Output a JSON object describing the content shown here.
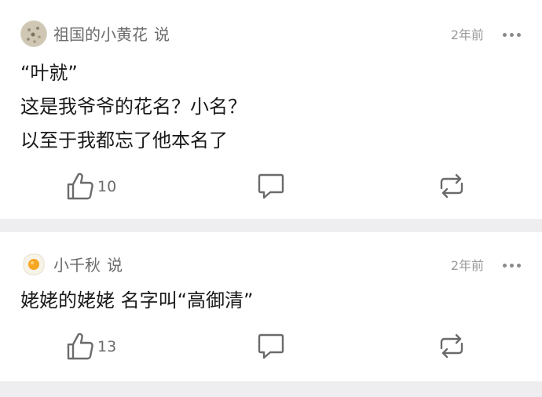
{
  "comments": [
    {
      "username": "祖国的小黄花",
      "said": "说",
      "time": "2年前",
      "lines": [
        "“叶就”",
        "这是我爷爷的花名？小名？",
        "以至于我都忘了他本名了"
      ],
      "likes": "10",
      "avatar_icon": "flower-avatar-icon"
    },
    {
      "username": "小千秋",
      "said": "说",
      "time": "2年前",
      "lines": [
        "姥姥的姥姥 名字叫“高御清”"
      ],
      "likes": "13",
      "avatar_icon": "fried-egg-avatar-icon"
    }
  ],
  "icons": {
    "more": "more-dots-icon",
    "like": "thumbs-up-icon",
    "comment": "comment-bubble-icon",
    "repost": "repost-icon"
  },
  "colors": {
    "background": "#eeeef0",
    "card": "#ffffff",
    "username": "#6b6b6b",
    "time": "#9a9a9a",
    "icon": "#6b6b6b"
  }
}
